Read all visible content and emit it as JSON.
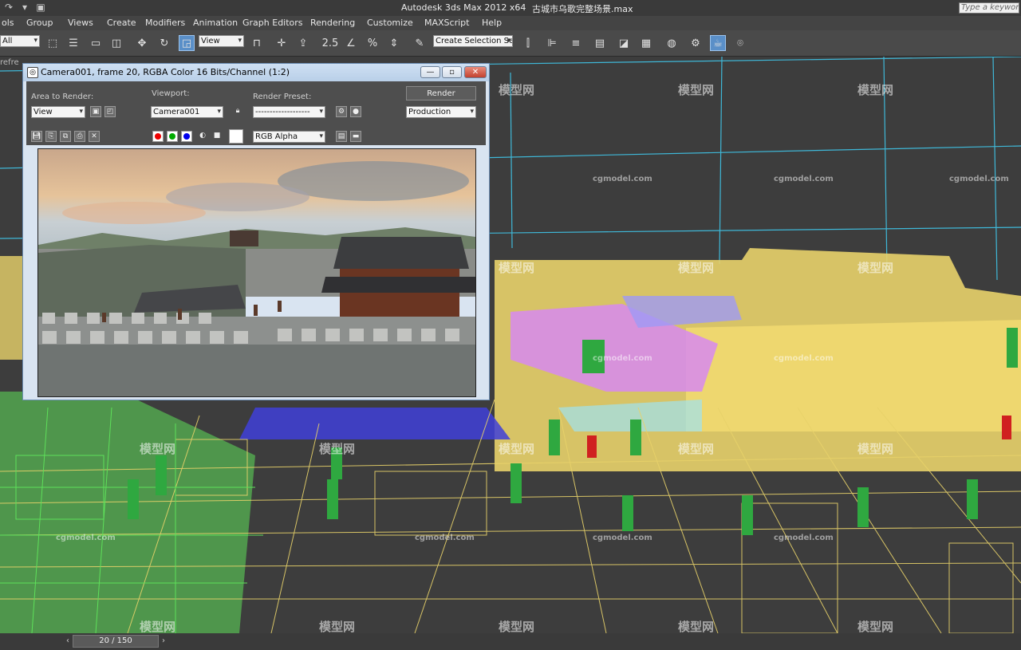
{
  "app": {
    "title": "Autodesk 3ds Max  2012 x64",
    "file": "古城市乌歌完整场景.max",
    "search_placeholder": "Type a keyword"
  },
  "menu": [
    "ols",
    "Group",
    "Views",
    "Create",
    "Modifiers",
    "Animation",
    "Graph Editors",
    "Rendering",
    "Customize",
    "MAXScript",
    "Help"
  ],
  "toolbar": {
    "selection_filter": "All",
    "ref_coord": "View",
    "named_selection": "Create Selection Se"
  },
  "viewport": {
    "label": "refre"
  },
  "render_window": {
    "title": "Camera001, frame 20, RGBA Color 16 Bits/Channel (1:2)",
    "area_label": "Area to Render:",
    "area_value": "View",
    "viewport_label": "Viewport:",
    "viewport_value": "Camera001",
    "preset_label": "Render Preset:",
    "preset_value": "-------------------",
    "render_button": "Render",
    "production_value": "Production",
    "channel_value": "RGB Alpha",
    "controls": {
      "minimize": "—",
      "maximize": "▫",
      "close": "✕"
    }
  },
  "timeline": {
    "frame": "20 / 150"
  },
  "watermarks": {
    "logo": "模型网",
    "site": "cgmodel.com"
  },
  "colors": {
    "wire_yellow": "#e8d26a",
    "wire_green": "#5ee05a",
    "wire_purple": "#d78af0",
    "wire_blue": "#3f3fd8",
    "grid_cyan": "#3fb8d8"
  }
}
